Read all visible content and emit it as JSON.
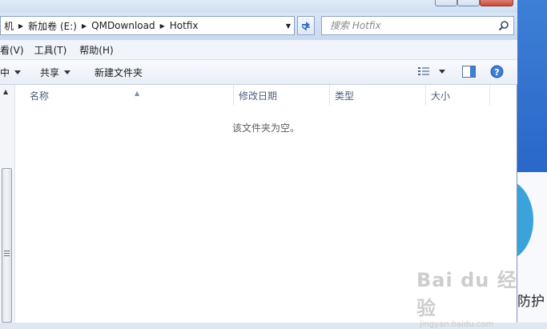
{
  "address": {
    "crumbs": [
      "机",
      "新加卷 (E:)",
      "QMDownload",
      "Hotfix"
    ]
  },
  "search": {
    "placeholder": "搜索 Hotfix"
  },
  "menu": {
    "items": [
      "看(V)",
      "工具(T)",
      "帮助(H)"
    ]
  },
  "toolbar": {
    "include_label": "中",
    "share_label": "共享",
    "new_folder_label": "新建文件夹"
  },
  "columns": [
    "名称",
    "修改日期",
    "类型",
    "大小"
  ],
  "content": {
    "empty_message": "该文件夹为空。"
  },
  "desktop": {
    "partial_text": "防护"
  },
  "watermark": {
    "main": "Bai du 经验",
    "sub": "jingyan.baidu.com"
  },
  "colors": {
    "accent": "#2a67c8",
    "window_frame": "#c9daf0"
  },
  "icons": [
    "chevron-right-icon",
    "dropdown-arrow-icon",
    "refresh-icon",
    "search-icon",
    "view-options-icon",
    "preview-pane-icon",
    "help-icon",
    "sort-up-icon",
    "scroll-up-icon"
  ]
}
